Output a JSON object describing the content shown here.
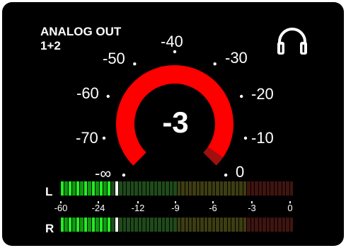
{
  "channel": {
    "name_line1": "ANALOG OUT",
    "name_line2": "1+2"
  },
  "monitor": {
    "icon": "headphones-icon"
  },
  "knob": {
    "value": "-3",
    "level_db": -3,
    "scale": [
      "-∞",
      "-70",
      "-60",
      "-50",
      "-40",
      "-30",
      "-20",
      "-10",
      "0"
    ],
    "colors": {
      "arc": "#ff0000",
      "arc_dim": "#a01010"
    }
  },
  "meters": {
    "left_label": "L",
    "right_label": "R",
    "scale": [
      "-60",
      "-24",
      "-12",
      "-9",
      "-6",
      "-3",
      "0"
    ],
    "left_level": 0.22,
    "right_level": 0.22,
    "peak_hold": 0.23,
    "colors": {
      "active": "#22ee22",
      "peak": "#ffffff",
      "inactive_green": "#1f4a1a",
      "inactive_yellow": "#3d3d12",
      "inactive_red": "#401410"
    }
  }
}
